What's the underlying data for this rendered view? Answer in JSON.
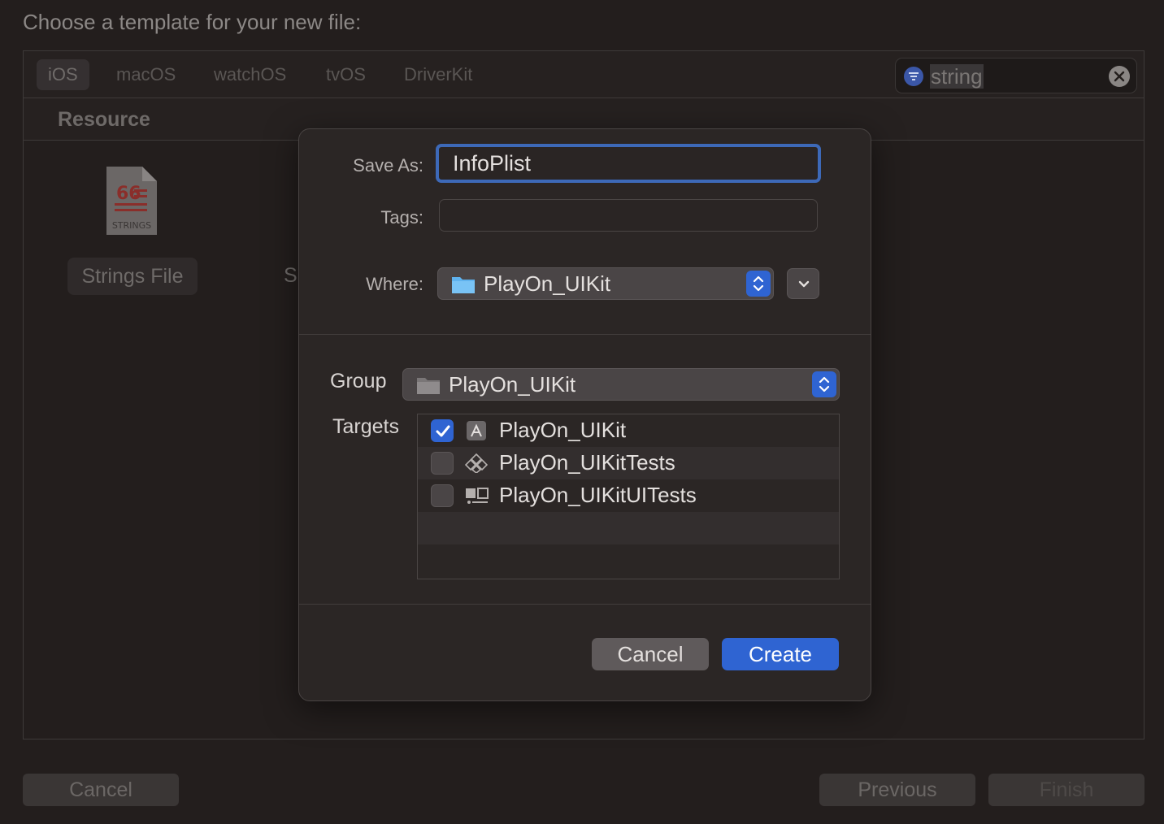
{
  "window": {
    "title": "Choose a template for your new file:"
  },
  "platform_tabs": [
    "iOS",
    "macOS",
    "watchOS",
    "tvOS",
    "DriverKit"
  ],
  "search": {
    "value": "string"
  },
  "section": {
    "title": "Resource"
  },
  "templates": {
    "strings_file_label": "Strings File",
    "strings_icon_caption": "STRINGS",
    "second_label_partial": "S"
  },
  "bottom_buttons": {
    "cancel": "Cancel",
    "previous": "Previous",
    "finish": "Finish"
  },
  "sheet": {
    "save_as_label": "Save As:",
    "save_as_value": "InfoPlist",
    "tags_label": "Tags:",
    "tags_value": "",
    "where_label": "Where:",
    "where_value": "PlayOn_UIKit",
    "group_label": "Group",
    "group_value": "PlayOn_UIKit",
    "targets_label": "Targets",
    "targets": [
      {
        "name": "PlayOn_UIKit",
        "checked": true,
        "icon": "app-target-icon"
      },
      {
        "name": "PlayOn_UIKitTests",
        "checked": false,
        "icon": "unit-test-icon"
      },
      {
        "name": "PlayOn_UIKitUITests",
        "checked": false,
        "icon": "ui-test-icon"
      }
    ],
    "cancel_label": "Cancel",
    "create_label": "Create"
  },
  "colors": {
    "accent": "#2f64d2",
    "focus_ring": "#3d69b8",
    "background": "#231e1d",
    "sheet_background": "#2b2625"
  }
}
